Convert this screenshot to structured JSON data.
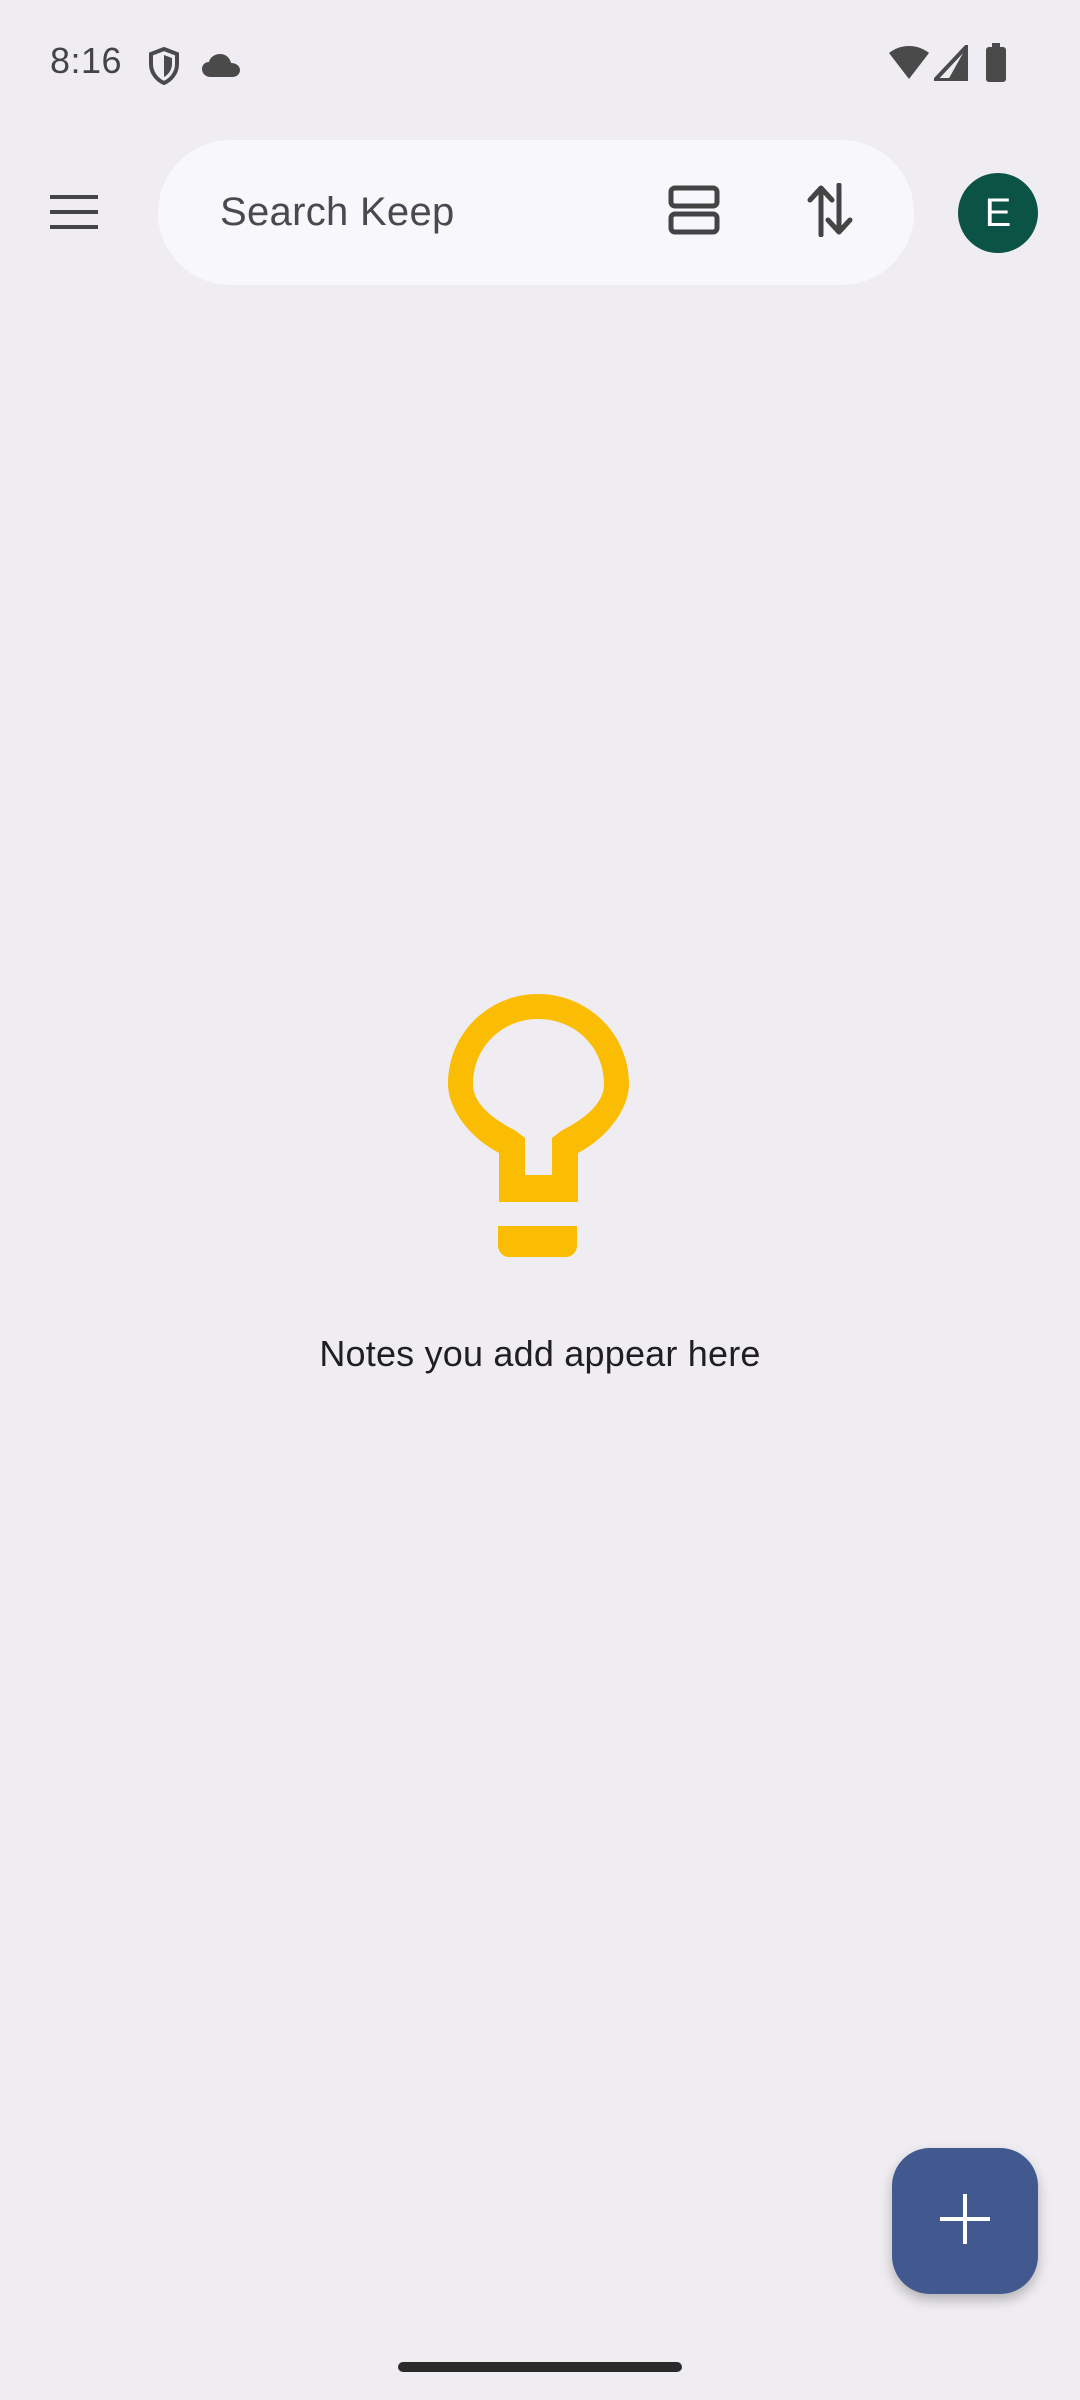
{
  "status_bar": {
    "time": "8:16",
    "left_icons": [
      "shield-icon",
      "cloud-icon"
    ],
    "right_icons": [
      "wifi-icon",
      "cell-signal-icon",
      "battery-icon"
    ]
  },
  "top_bar": {
    "menu_icon": "menu-icon",
    "search": {
      "placeholder": "Search Keep"
    },
    "layout_icon": "list-view-icon",
    "sort_icon": "sort-icon",
    "avatar": {
      "initial": "E",
      "color": "#0b5345"
    }
  },
  "empty_state": {
    "icon": "lightbulb-icon",
    "icon_color": "#fbbc04",
    "message": "Notes you add appear here"
  },
  "fab": {
    "icon": "add-icon",
    "color": "#41598e"
  },
  "colors": {
    "background": "#efedf1",
    "search_bar": "#f8f8fc"
  }
}
